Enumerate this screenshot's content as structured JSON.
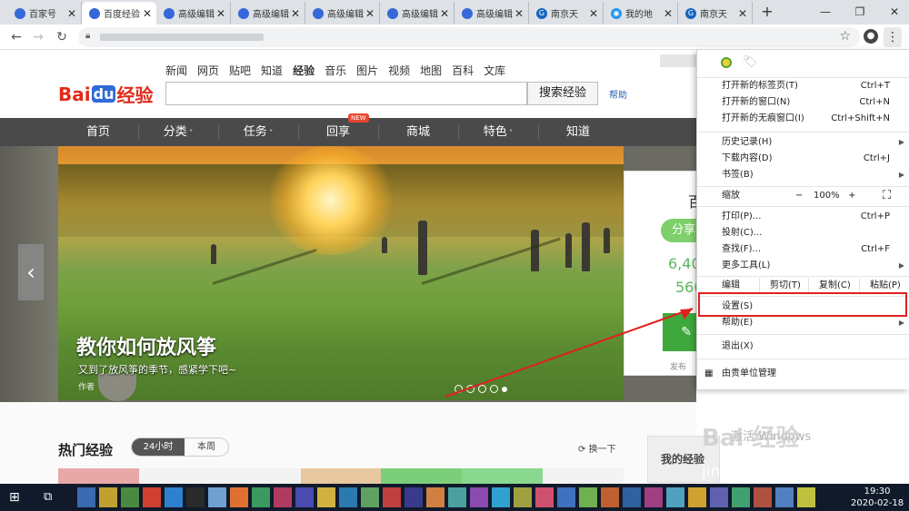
{
  "browser": {
    "tabs": [
      {
        "title": "百家号",
        "icon": "paw-icon",
        "active": false
      },
      {
        "title": "百度经验",
        "icon": "paw-icon",
        "active": true
      },
      {
        "title": "高级编辑",
        "icon": "paw-icon",
        "active": false
      },
      {
        "title": "高级编辑",
        "icon": "paw-icon",
        "active": false
      },
      {
        "title": "高级编辑",
        "icon": "paw-icon",
        "active": false
      },
      {
        "title": "高级编辑",
        "icon": "paw-icon",
        "active": false
      },
      {
        "title": "高级编辑",
        "icon": "paw-icon",
        "active": false
      },
      {
        "title": "南京天",
        "icon": "g-circle-icon",
        "active": false
      },
      {
        "title": "我的地",
        "icon": "egg-icon",
        "active": false
      },
      {
        "title": "南京天",
        "icon": "g-circle-icon",
        "active": false
      }
    ],
    "tab_close_glyph": "✕",
    "new_tab_glyph": "+",
    "window_controls": [
      "—",
      "❐",
      "✕"
    ]
  },
  "site": {
    "logo": {
      "bai": "Bai",
      "du": "du",
      "jingyan": "经验"
    },
    "top_nav": [
      "新闻",
      "网页",
      "贴吧",
      "知道",
      "经验",
      "音乐",
      "图片",
      "视频",
      "地图",
      "百科",
      "文库"
    ],
    "current_top_nav": "经验",
    "search_button": "搜索经验",
    "help_link": "帮助",
    "main_nav": [
      "首页",
      "分类",
      "任务",
      "回享",
      "商城",
      "特色",
      "知道"
    ],
    "main_nav_dropdown": [
      false,
      true,
      true,
      false,
      false,
      true,
      false
    ],
    "new_badge": "NEW",
    "hero": {
      "title": "教你如何放风筝",
      "subtitle": "又到了放风筝的季节，感紧学下吧~",
      "author_label": "作者"
    },
    "stats_panel": {
      "heading": "百",
      "share": "分享",
      "stat1": "6,40",
      "stat2": "560",
      "write_icon": "✎",
      "fabu": "发布"
    },
    "hot": {
      "title": "热门经验",
      "seg_on": "24小时",
      "seg_off": "本周",
      "refresh": "换一下"
    },
    "right_panel_title": "我的经验"
  },
  "menu": {
    "items_group1": [
      {
        "label": "打开新的标签页(T)",
        "shortcut": "Ctrl+T"
      },
      {
        "label": "打开新的窗口(N)",
        "shortcut": "Ctrl+N"
      },
      {
        "label": "打开新的无痕窗口(I)",
        "shortcut": "Ctrl+Shift+N"
      }
    ],
    "items_group2": [
      {
        "label": "历史记录(H)",
        "shortcut": "",
        "arrow": true
      },
      {
        "label": "下载内容(D)",
        "shortcut": "Ctrl+J",
        "arrow": false
      },
      {
        "label": "书签(B)",
        "shortcut": "",
        "arrow": true
      }
    ],
    "zoom": {
      "label": "缩放",
      "minus": "−",
      "value": "100%",
      "plus": "+"
    },
    "items_group3": [
      {
        "label": "打印(P)...",
        "shortcut": "Ctrl+P",
        "arrow": false
      },
      {
        "label": "投射(C)...",
        "shortcut": "",
        "arrow": false
      },
      {
        "label": "查找(F)...",
        "shortcut": "Ctrl+F",
        "arrow": false
      },
      {
        "label": "更多工具(L)",
        "shortcut": "",
        "arrow": true
      }
    ],
    "edit": {
      "label": "编辑",
      "cut": "剪切(T)",
      "copy": "复制(C)",
      "paste": "粘贴(P)"
    },
    "settings": "设置(S)",
    "help": "帮助(E)",
    "exit": "退出(X)",
    "managed": "由贵单位管理"
  },
  "taskbar": {
    "time": "19:30",
    "date": "2020-02-18"
  },
  "watermark": {
    "logo": "Bai 经验",
    "url": "jingyan.baidu.com",
    "activate": "激活 Windows"
  },
  "colors": {
    "highlight": "#e02020",
    "baidu_red": "#e12a1a",
    "baidu_blue": "#2f6ad9"
  }
}
